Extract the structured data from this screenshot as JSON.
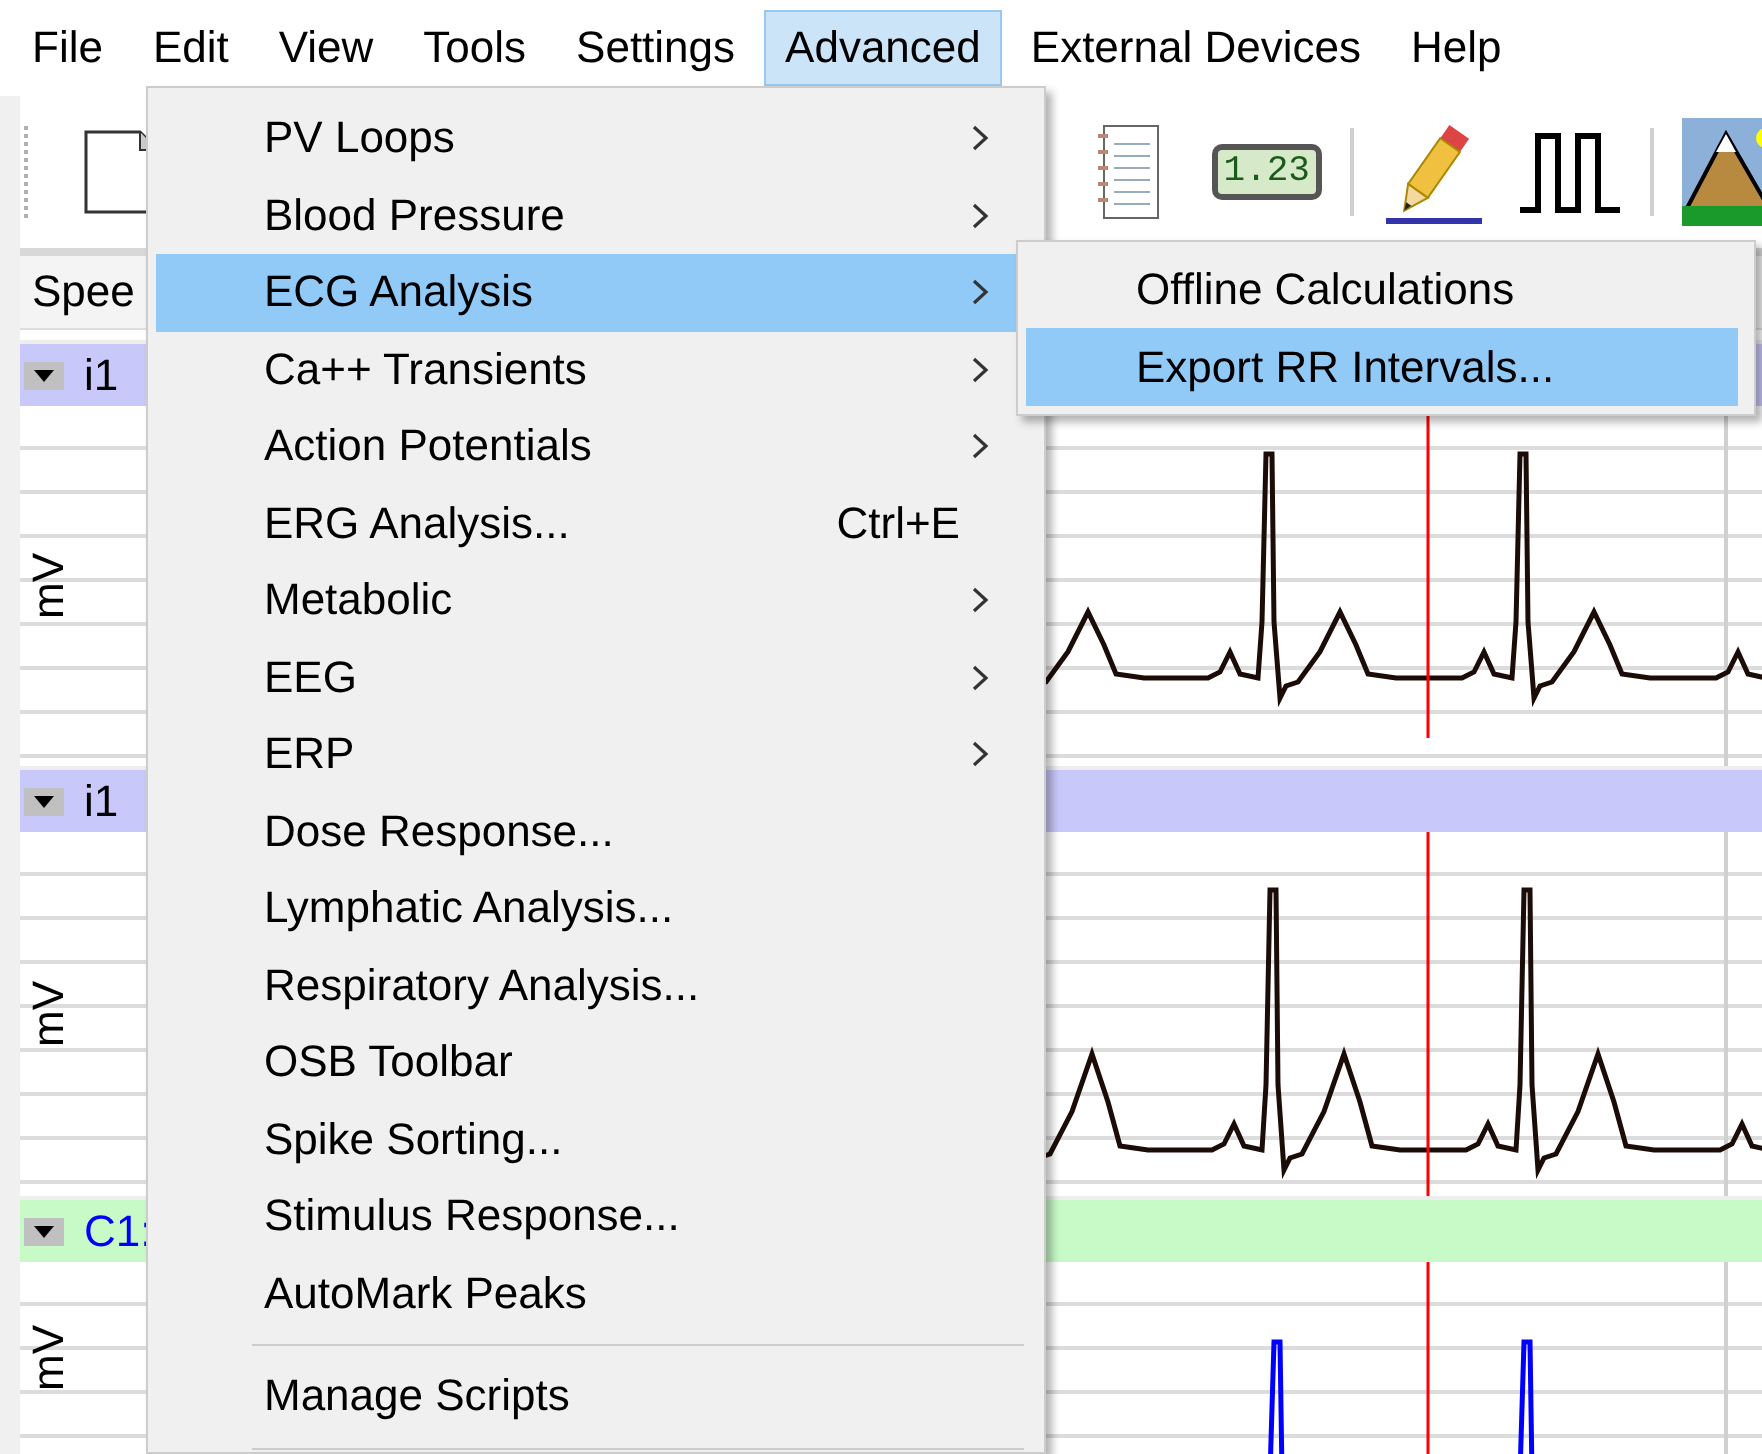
{
  "menu_bar": [
    {
      "label": "File",
      "selected": false
    },
    {
      "label": "Edit",
      "selected": false
    },
    {
      "label": "View",
      "selected": false
    },
    {
      "label": "Tools",
      "selected": false
    },
    {
      "label": "Settings",
      "selected": false
    },
    {
      "label": "Advanced",
      "selected": true
    },
    {
      "label": "External Devices",
      "selected": false
    },
    {
      "label": "Help",
      "selected": false
    }
  ],
  "toolbar": {
    "display_text": "1.23"
  },
  "speed_label": "Spee",
  "channels": [
    {
      "name": "i1",
      "kind": "input",
      "color": "#c8c8fa",
      "unit": "mV"
    },
    {
      "name": "i1",
      "kind": "input",
      "color": "#c8c8fa",
      "unit": "mV"
    },
    {
      "name": "C1:",
      "kind": "calculated",
      "color": "#c8fac8",
      "unit": "mV"
    }
  ],
  "menu": {
    "items": [
      {
        "kind": "item",
        "label": "PV Loops",
        "has_submenu": true,
        "selected": false
      },
      {
        "kind": "item",
        "label": "Blood Pressure",
        "has_submenu": true,
        "selected": false
      },
      {
        "kind": "item",
        "label": "ECG Analysis",
        "has_submenu": true,
        "selected": true
      },
      {
        "kind": "item",
        "label": "Ca++ Transients",
        "has_submenu": true,
        "selected": false
      },
      {
        "kind": "item",
        "label": "Action Potentials",
        "has_submenu": true,
        "selected": false
      },
      {
        "kind": "item",
        "label": "ERG Analysis...",
        "shortcut": "Ctrl+E",
        "has_submenu": false,
        "selected": false
      },
      {
        "kind": "item",
        "label": "Metabolic",
        "has_submenu": true,
        "selected": false
      },
      {
        "kind": "item",
        "label": "EEG",
        "has_submenu": true,
        "selected": false
      },
      {
        "kind": "item",
        "label": "ERP",
        "has_submenu": true,
        "selected": false
      },
      {
        "kind": "item",
        "label": "Dose Response...",
        "has_submenu": false,
        "selected": false
      },
      {
        "kind": "item",
        "label": "Lymphatic Analysis...",
        "has_submenu": false,
        "selected": false
      },
      {
        "kind": "item",
        "label": "Respiratory Analysis...",
        "has_submenu": false,
        "selected": false
      },
      {
        "kind": "item",
        "label": "OSB Toolbar",
        "has_submenu": false,
        "selected": false
      },
      {
        "kind": "item",
        "label": "Spike Sorting...",
        "has_submenu": false,
        "selected": false
      },
      {
        "kind": "item",
        "label": "Stimulus Response...",
        "has_submenu": false,
        "selected": false
      },
      {
        "kind": "item",
        "label": "AutoMark Peaks",
        "has_submenu": false,
        "selected": false
      },
      {
        "kind": "separator"
      },
      {
        "kind": "item",
        "label": "Manage Scripts",
        "has_submenu": false,
        "selected": false
      },
      {
        "kind": "separator"
      }
    ]
  },
  "submenu": {
    "items": [
      {
        "label": "Offline Calculations",
        "selected": false
      },
      {
        "label": "Export RR Intervals...",
        "selected": true
      }
    ]
  }
}
